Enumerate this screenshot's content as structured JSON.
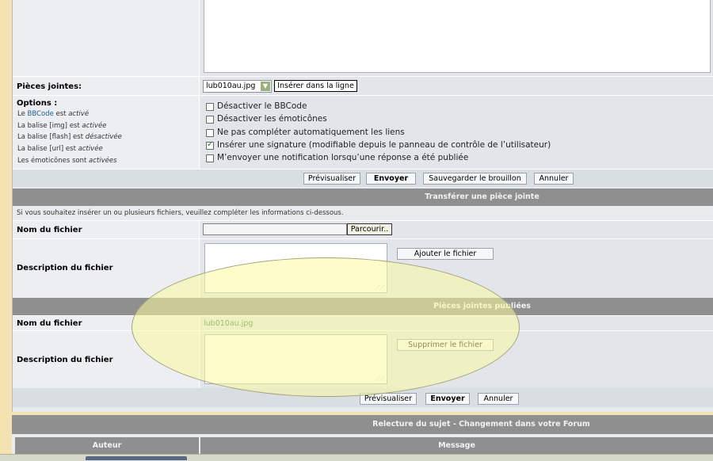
{
  "attachments": {
    "label": "Pièces jointes:",
    "selected_file": "lub010au.jpg",
    "insert_button": "Insérer dans la ligne"
  },
  "options": {
    "title": "Options :",
    "info": [
      {
        "pre": "Le ",
        "link": "BBCode",
        "post": " est ",
        "state": "activé"
      },
      {
        "pre": "La balise [img] est ",
        "link": "",
        "post": "",
        "state": "activée"
      },
      {
        "pre": "La balise [flash] est ",
        "link": "",
        "post": "",
        "state": "désactivée"
      },
      {
        "pre": "La balise [url] est ",
        "link": "",
        "post": "",
        "state": "activée"
      },
      {
        "pre": "Les émoticônes sont ",
        "link": "",
        "post": "",
        "state": "activées"
      }
    ],
    "checkboxes": [
      {
        "label": "Désactiver le BBCode",
        "checked": false
      },
      {
        "label": "Désactiver les émoticônes",
        "checked": false
      },
      {
        "label": "Ne pas compléter automatiquement les liens",
        "checked": false
      },
      {
        "label": "Insérer une signature (modifiable depuis le panneau de contrôle de l’utilisateur)",
        "checked": true
      },
      {
        "label": "M’envoyer une notification lorsqu’une réponse a été publiée",
        "checked": false
      }
    ]
  },
  "actions": {
    "preview": "Prévisualiser",
    "send": "Envoyer",
    "save_draft": "Sauvegarder le brouillon",
    "cancel": "Annuler"
  },
  "upload": {
    "header": "Transférer une pièce jointe",
    "hint": "Si vous souhaitez insérer un ou plusieurs fichiers, veuillez compléter les informations ci-dessous.",
    "filename_label": "Nom du fichier",
    "browse": "Parcourir..",
    "description_label": "Description du fichier",
    "add_button": "Ajouter le fichier"
  },
  "published": {
    "header": "Pièces jointes publiées",
    "filename_label": "Nom du fichier",
    "filename": "lub010au.jpg",
    "description_label": "Description du fichier",
    "delete_button": "Supprimer le fichier"
  },
  "bottom_actions": {
    "preview": "Prévisualiser",
    "send": "Envoyer",
    "cancel": "Annuler"
  },
  "review": {
    "header": "Relecture du sujet - Changement dans votre Forum",
    "col_author": "Auteur",
    "col_message": "Message"
  }
}
